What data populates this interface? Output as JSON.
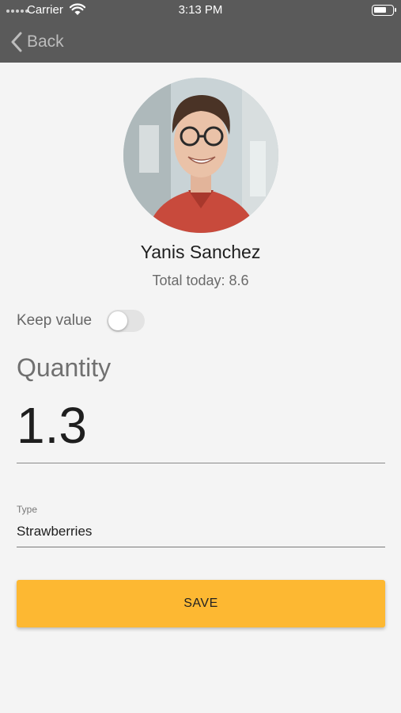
{
  "status_bar": {
    "carrier": "Carrier",
    "time": "3:13 PM"
  },
  "nav": {
    "back_label": "Back"
  },
  "profile": {
    "name": "Yanis Sanchez",
    "total_today": "Total today: 8.6"
  },
  "keep_value": {
    "label": "Keep value",
    "enabled": false
  },
  "quantity": {
    "label": "Quantity",
    "value": "1.3"
  },
  "type": {
    "label": "Type",
    "value": "Strawberries"
  },
  "save_button": {
    "label": "SAVE"
  },
  "colors": {
    "topbar": "#5a5a5a",
    "background": "#f4f4f4",
    "accent": "#fdb832"
  }
}
